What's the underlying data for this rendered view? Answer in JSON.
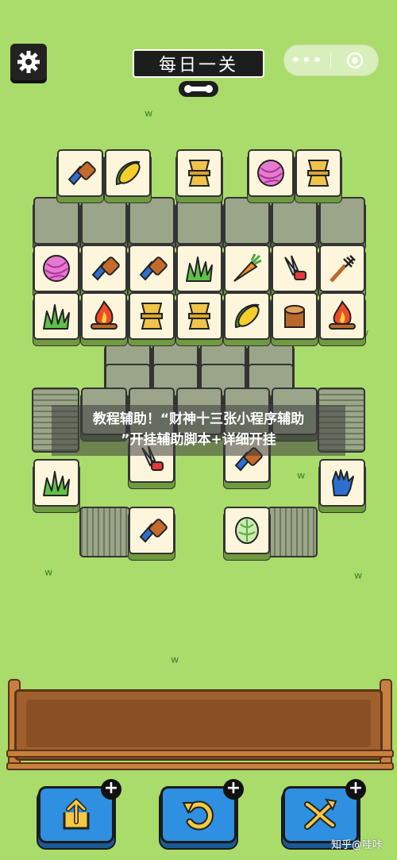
{
  "header": {
    "title": "每日一关",
    "capsule_menu": "•••"
  },
  "banner": {
    "line1": "教程辅助！“财神十三张小程序辅助",
    "line2": "”开挂辅助脚本+详细开挂"
  },
  "watermark": "知乎@哇咔",
  "tiles": [
    {
      "icon": "brush"
    },
    {
      "icon": "corn"
    },
    {
      "icon": "wheat"
    },
    {
      "icon": "yarn"
    },
    {
      "icon": "wheat"
    },
    {
      "icon": "yarn"
    },
    {
      "icon": "brush"
    },
    {
      "icon": "brush"
    },
    {
      "icon": "grass"
    },
    {
      "icon": "carrot"
    },
    {
      "icon": "shears"
    },
    {
      "icon": "fork"
    },
    {
      "icon": "grass"
    },
    {
      "icon": "fire"
    },
    {
      "icon": "wheat"
    },
    {
      "icon": "wheat"
    },
    {
      "icon": "corn"
    },
    {
      "icon": "stump"
    },
    {
      "icon": "fire"
    },
    {
      "icon": "grass"
    },
    {
      "icon": "shears"
    },
    {
      "icon": "brush"
    },
    {
      "icon": "glove"
    },
    {
      "icon": "brush"
    },
    {
      "icon": "cabbage"
    }
  ],
  "powerups": [
    {
      "name": "move-out",
      "icon": "arrow-up-out-icon",
      "badge": "+"
    },
    {
      "name": "undo",
      "icon": "undo-icon",
      "badge": "+"
    },
    {
      "name": "shuffle",
      "icon": "shuffle-icon",
      "badge": "+"
    }
  ],
  "colors": {
    "background": "#a9dc6a",
    "tile": "#fdf6dc",
    "button": "#2f8fe0"
  }
}
